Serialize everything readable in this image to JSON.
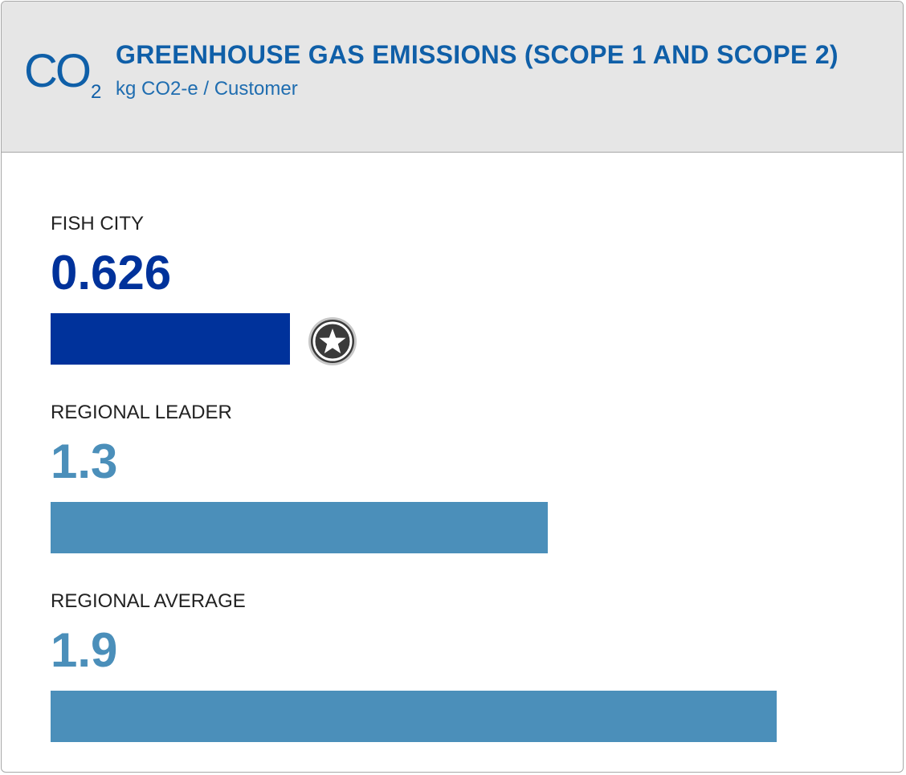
{
  "header": {
    "icon_text": "CO",
    "icon_subscript": "2",
    "title": "GREENHOUSE GAS EMISSIONS (SCOPE 1 AND SCOPE 2)",
    "subtitle": "kg CO2-e / Customer"
  },
  "colors": {
    "highlight": "#00329b",
    "comparison": "#4b8fba",
    "header_text": "#0f5fa8",
    "header_bg": "#e6e6e6"
  },
  "chart_data": {
    "type": "bar",
    "orientation": "horizontal",
    "title": "GREENHOUSE GAS EMISSIONS (SCOPE 1 AND SCOPE 2)",
    "subtitle": "kg CO2-e / Customer",
    "categories": [
      "FISH CITY",
      "REGIONAL LEADER",
      "REGIONAL AVERAGE"
    ],
    "values": [
      0.626,
      1.3,
      1.9
    ],
    "value_labels": [
      "0.626",
      "1.3",
      "1.9"
    ],
    "xlim": [
      0,
      1.9
    ],
    "grid": false,
    "highlighted": "FISH CITY",
    "badge_icon": "star-badge-icon"
  }
}
